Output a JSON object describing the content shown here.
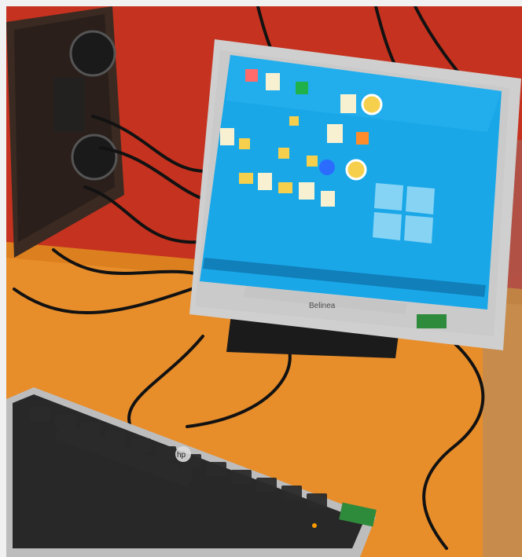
{
  "scene": {
    "monitor_brand": "Belinea",
    "keyboard_brand": "hp",
    "colors": {
      "wall": "#c8321f",
      "desk": "#e78d2a",
      "screen": "#1aa7e8",
      "monitor_bezel": "#cfcfcf",
      "keyboard_keys": "#1b1b1b",
      "keyboard_frame": "#bdbdbd",
      "cable": "#121212",
      "green_sticker": "#2f8b3c"
    },
    "desktop_icons": [
      "folder-icon",
      "document-icon",
      "app-icon",
      "disc-icon",
      "image-icon",
      "settings-icon"
    ]
  }
}
